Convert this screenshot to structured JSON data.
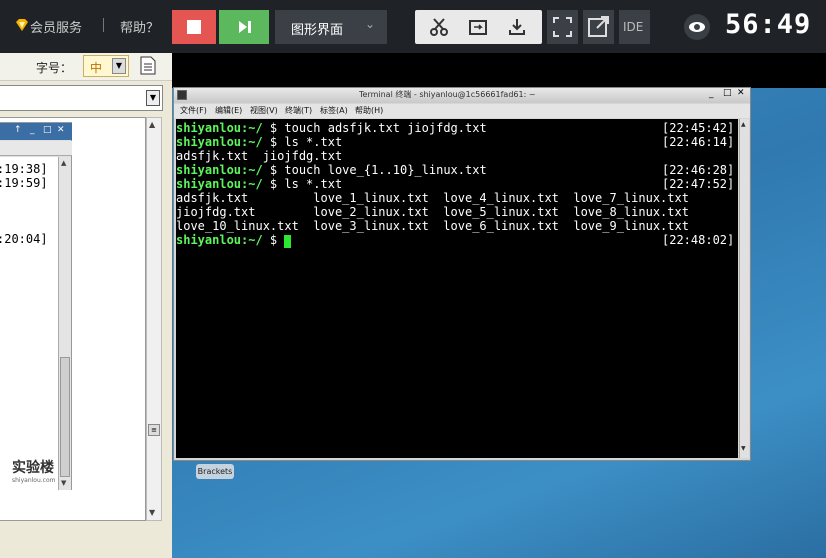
{
  "topbar": {
    "member_label": "会员服务",
    "help_label": "帮助？",
    "mode_label": "图形界面",
    "ide_label": "IDE",
    "timer": "56:49"
  },
  "left_app": {
    "font_size_label": "字号：",
    "font_size_value": "中",
    "timestamps": [
      ":19:38]",
      ":19:59]",
      ":20:04]"
    ],
    "brand_name": "实验楼",
    "brand_url": "shiyanlou.com"
  },
  "terminal": {
    "title": "Terminal 终端 - shiyanlou@1c56661fad61: ~",
    "menu": [
      "文件(F)",
      "编辑(E)",
      "视图(V)",
      "终端(T)",
      "标签(A)",
      "帮助(H)"
    ],
    "lines": [
      {
        "prompt": "shiyanlou:~/",
        "text": " $ touch adsfjk.txt jiojfdg.txt",
        "time": "[22:45:42]"
      },
      {
        "prompt": "shiyanlou:~/",
        "text": " $ ls *.txt",
        "time": "[22:46:14]"
      },
      {
        "prompt": "",
        "text": "adsfjk.txt  jiojfdg.txt",
        "time": ""
      },
      {
        "prompt": "shiyanlou:~/",
        "text": " $ touch love_{1..10}_linux.txt",
        "time": "[22:46:28]"
      },
      {
        "prompt": "shiyanlou:~/",
        "text": " $ ls *.txt",
        "time": "[22:47:52]"
      },
      {
        "prompt": "",
        "text": "adsfjk.txt         love_1_linux.txt  love_4_linux.txt  love_7_linux.txt",
        "time": ""
      },
      {
        "prompt": "",
        "text": "jiojfdg.txt        love_2_linux.txt  love_5_linux.txt  love_8_linux.txt",
        "time": ""
      },
      {
        "prompt": "",
        "text": "love_10_linux.txt  love_3_linux.txt  love_6_linux.txt  love_9_linux.txt",
        "time": ""
      },
      {
        "prompt": "shiyanlou:~/",
        "text": " $ ",
        "time": "[22:48:02]"
      }
    ]
  },
  "desktop": {
    "icon_label": "Brackets"
  },
  "colors": {
    "stop": "#e55652",
    "play": "#5cb85c",
    "prompt": "#5cf55c",
    "desktop": "#3d8bc0"
  }
}
